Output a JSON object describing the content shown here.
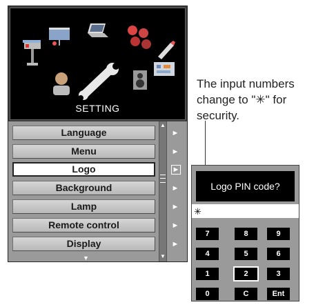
{
  "menu": {
    "title": "SETTING",
    "items": [
      {
        "label": "Language"
      },
      {
        "label": "Menu"
      },
      {
        "label": "Logo",
        "selected": true
      },
      {
        "label": "Background"
      },
      {
        "label": "Lamp"
      },
      {
        "label": "Remote control"
      },
      {
        "label": "Display"
      }
    ],
    "item_arrow": "►",
    "scroll_up": "▲",
    "scroll_down": "▼",
    "more_indicator": "▼",
    "icons": [
      "projector-stand-icon",
      "screen-icon",
      "laptop-icon",
      "dots-icon",
      "pencil-icon",
      "person-icon",
      "wrench-icon",
      "speaker-icon",
      "tools-icon"
    ]
  },
  "annotation": {
    "text": "The input numbers\nchange to \"✳\" for\nsecurity."
  },
  "pin_dialog": {
    "title": "Logo PIN code?",
    "input_value": "✳",
    "keys": [
      "7",
      "8",
      "9",
      "4",
      "5",
      "6",
      "1",
      "2",
      "3",
      "0",
      "C",
      "Ent"
    ],
    "active_key": "2"
  }
}
